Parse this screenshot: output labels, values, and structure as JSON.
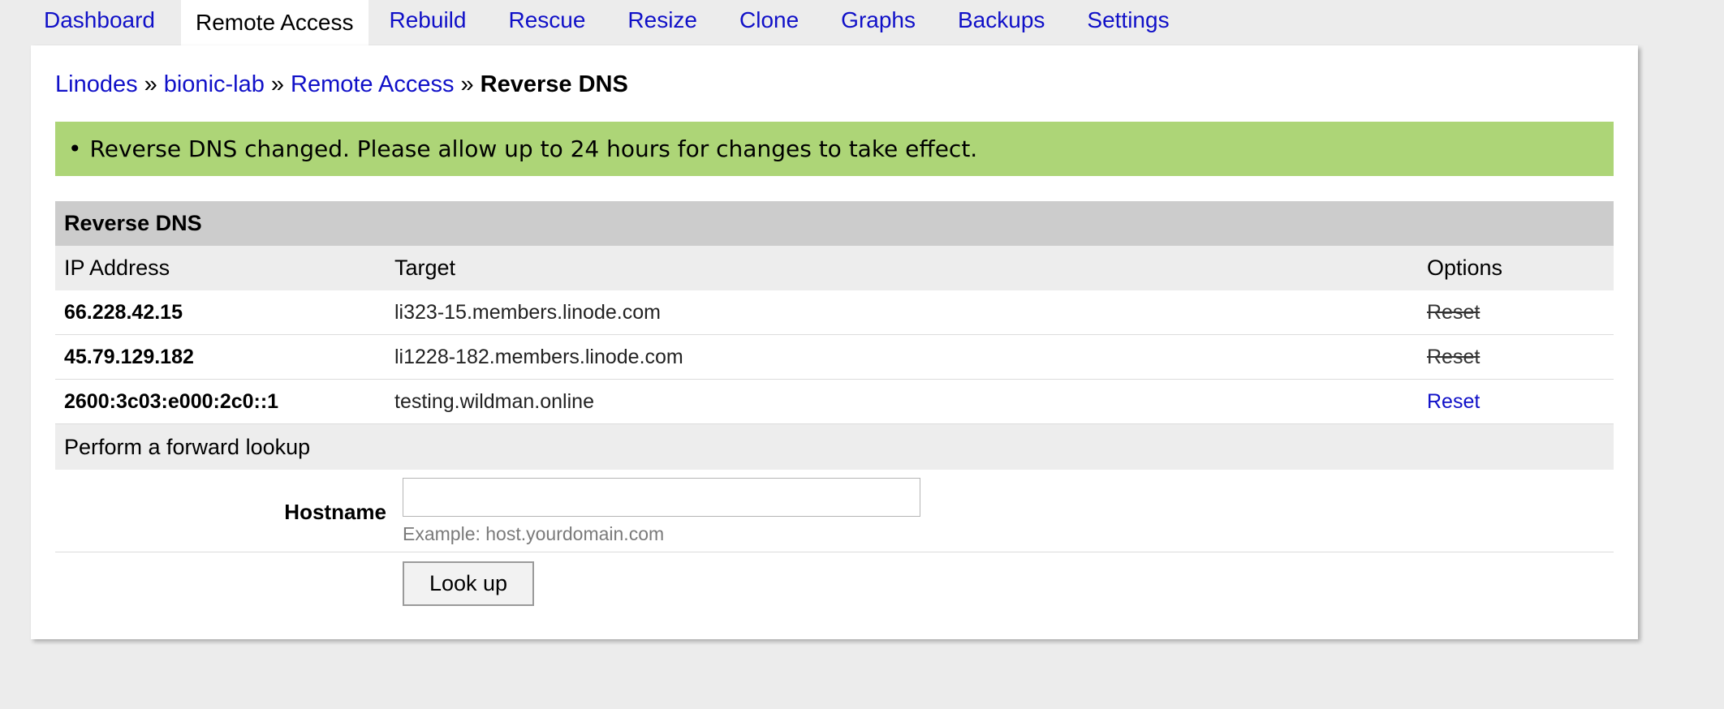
{
  "tabs": [
    {
      "label": "Dashboard",
      "active": false
    },
    {
      "label": "Remote Access",
      "active": true
    },
    {
      "label": "Rebuild",
      "active": false
    },
    {
      "label": "Rescue",
      "active": false
    },
    {
      "label": "Resize",
      "active": false
    },
    {
      "label": "Clone",
      "active": false
    },
    {
      "label": "Graphs",
      "active": false
    },
    {
      "label": "Backups",
      "active": false
    },
    {
      "label": "Settings",
      "active": false
    }
  ],
  "breadcrumb": {
    "items": [
      "Linodes",
      "bionic-lab",
      "Remote Access"
    ],
    "separator": "»",
    "current": "Reverse DNS"
  },
  "notice": {
    "bullet": "•",
    "text": "Reverse DNS changed. Please allow up to 24 hours for changes to take effect.",
    "color": "#add577"
  },
  "table": {
    "title": "Reverse DNS",
    "headers": {
      "ip": "IP Address",
      "target": "Target",
      "options": "Options"
    },
    "rows": [
      {
        "ip": "66.228.42.15",
        "target": "li323-15.members.linode.com",
        "option": "Reset",
        "enabled": false
      },
      {
        "ip": "45.79.129.182",
        "target": "li1228-182.members.linode.com",
        "option": "Reset",
        "enabled": false
      },
      {
        "ip": "2600:3c03:e000:2c0::1",
        "target": "testing.wildman.online",
        "option": "Reset",
        "enabled": true
      }
    ]
  },
  "lookup": {
    "heading": "Perform a forward lookup",
    "hostname_label": "Hostname",
    "hostname_value": "",
    "hostname_hint": "Example: host.yourdomain.com",
    "button_label": "Look up"
  },
  "colors": {
    "link": "#1010c8",
    "background": "#ececec",
    "panel": "#ffffff",
    "section_header": "#cccccc",
    "column_header": "#ededed"
  }
}
